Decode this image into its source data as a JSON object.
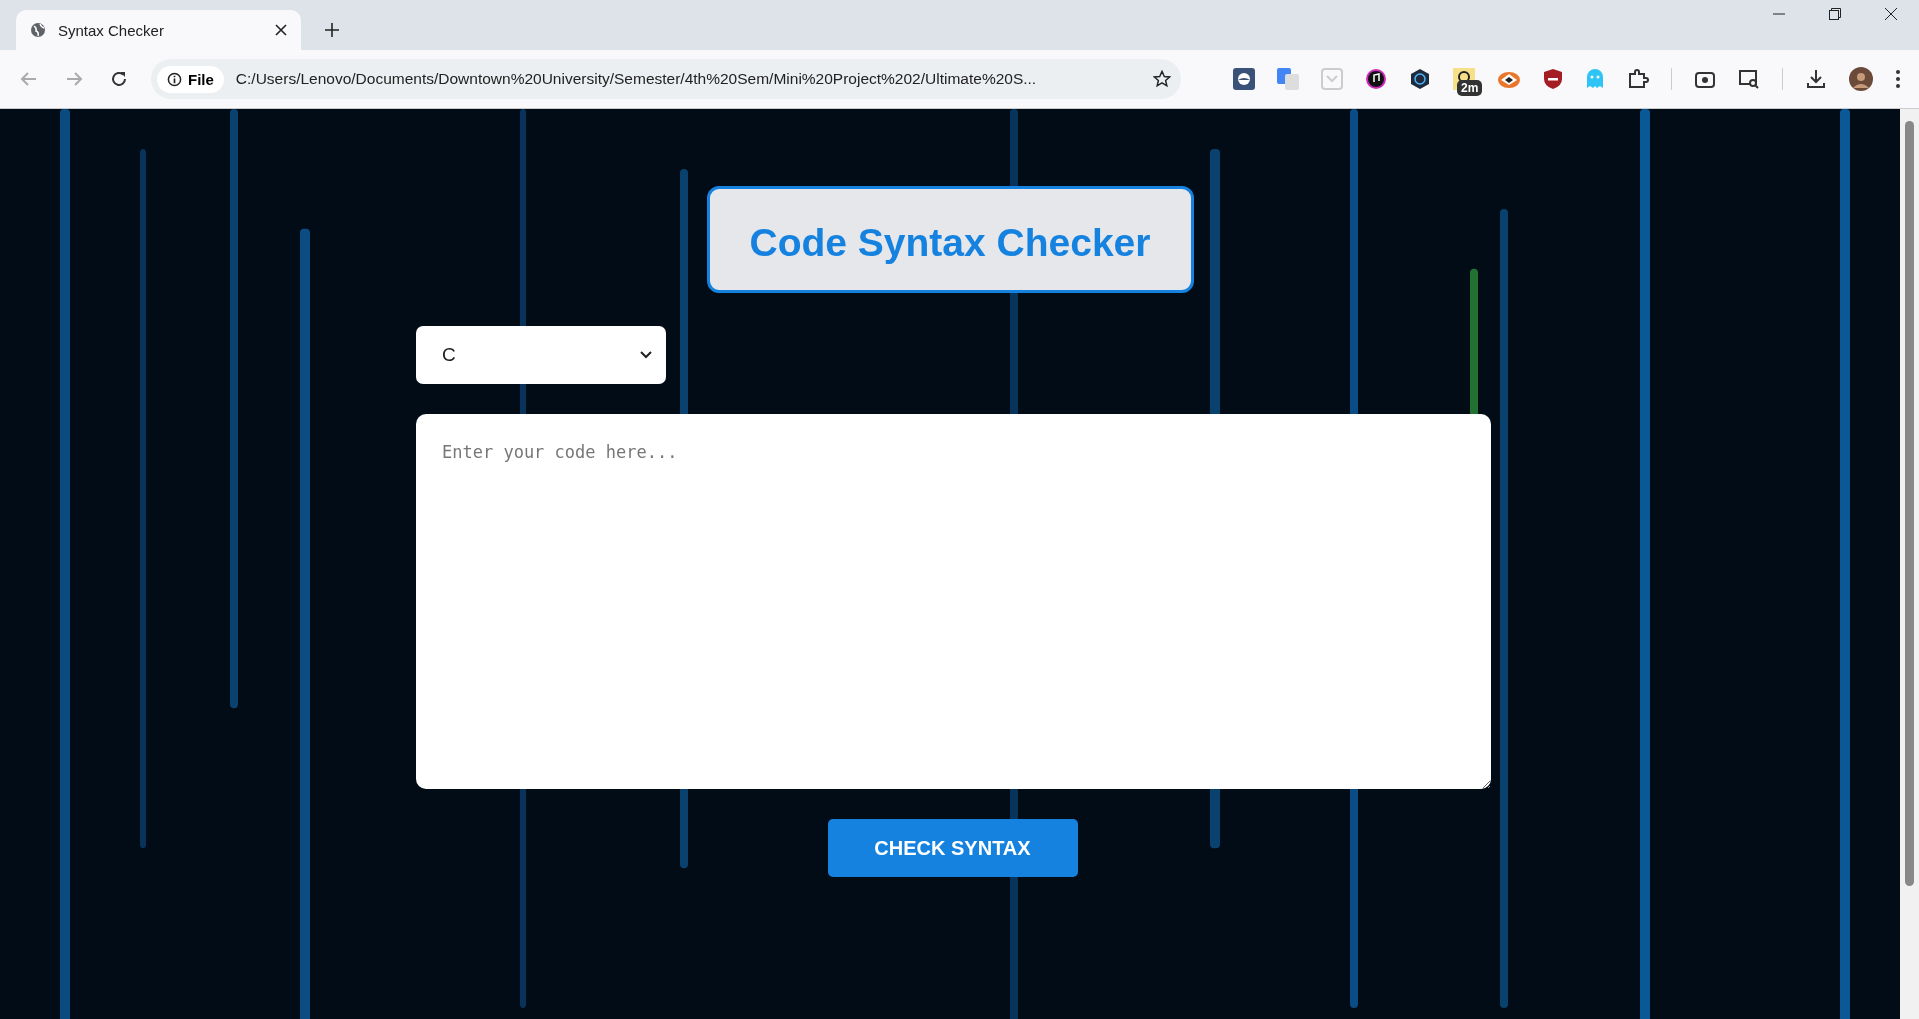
{
  "browser": {
    "tab": {
      "title": "Syntax Checker"
    },
    "address": {
      "scheme_label": "File",
      "url": "C:/Users/Lenovo/Documents/Downtown%20University/Semester/4th%20Sem/Mini%20Project%202/Ultimate%20S..."
    },
    "extension_badge": "2m"
  },
  "page": {
    "title": "Code Syntax Checker",
    "language_select": {
      "value": "C"
    },
    "code_input": {
      "placeholder": "Enter your code here..."
    },
    "check_button": {
      "label": "CHECK SYNTAX"
    }
  }
}
